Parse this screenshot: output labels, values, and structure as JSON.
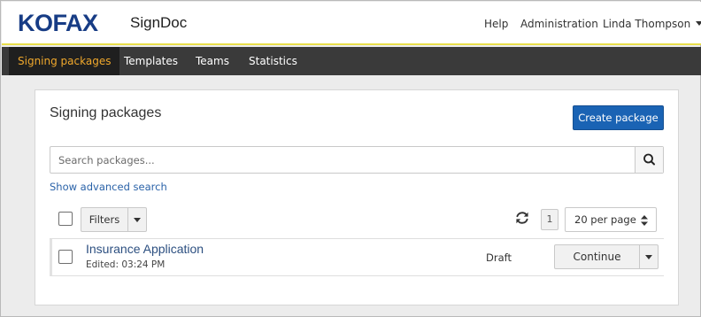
{
  "header": {
    "logo_text": "KOFAX",
    "app_name": "SignDoc",
    "links": {
      "help": "Help",
      "administration": "Administration"
    },
    "user_name": "Linda Thompson",
    "accent_color": "#e8de4a",
    "logo_color": "#173c85"
  },
  "navbar": {
    "items": [
      {
        "label": "Signing packages",
        "active": true
      },
      {
        "label": "Templates",
        "active": false
      },
      {
        "label": "Teams",
        "active": false
      },
      {
        "label": "Statistics",
        "active": false
      }
    ],
    "active_color": "#f0a82c"
  },
  "main": {
    "title": "Signing packages",
    "create_button": "Create package",
    "search": {
      "placeholder": "Search packages...",
      "value": "",
      "button_icon": "search-icon"
    },
    "advanced_search_link": "Show advanced search",
    "toolbar": {
      "filters_label": "Filters",
      "refresh_icon": "refresh-icon",
      "page_number": "1",
      "per_page_label": "20 per page"
    },
    "packages": [
      {
        "title": "Insurance Application",
        "edited": "Edited: 03:24 PM",
        "status": "Draft",
        "action": "Continue"
      }
    ]
  },
  "colors": {
    "primary": "#1a63b4",
    "navbar_bg": "#3a3a3a",
    "link": "#2a62a8"
  }
}
